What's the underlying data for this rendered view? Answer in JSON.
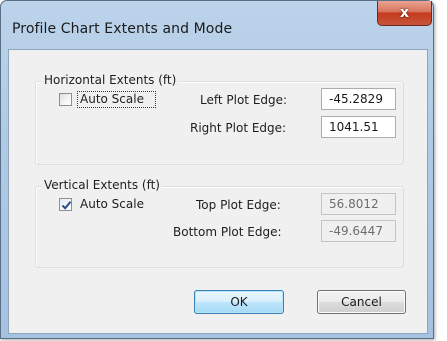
{
  "window": {
    "title": "Profile Chart Extents and Mode",
    "close_glyph": "x"
  },
  "horizontal": {
    "group_title": "Horizontal Extents (ft)",
    "auto_scale_label": "Auto Scale",
    "auto_scale_checked": false,
    "left_label": "Left Plot Edge:",
    "left_value": "-45.2829",
    "right_label": "Right Plot Edge:",
    "right_value": "1041.51"
  },
  "vertical": {
    "group_title": "Vertical Extents (ft)",
    "auto_scale_label": "Auto Scale",
    "auto_scale_checked": true,
    "top_label": "Top Plot Edge:",
    "top_value": "56.8012",
    "bottom_label": "Bottom Plot Edge:",
    "bottom_value": "-49.6447"
  },
  "buttons": {
    "ok": "OK",
    "cancel": "Cancel"
  },
  "icons": {
    "close": "close-icon",
    "check": "checkmark-icon"
  }
}
